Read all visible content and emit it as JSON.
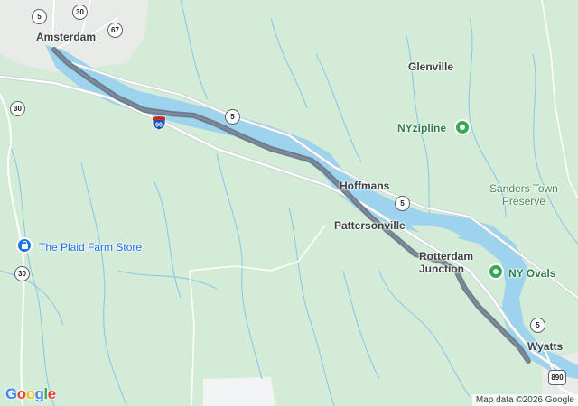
{
  "map": {
    "places": {
      "amsterdam": "Amsterdam",
      "glenville": "Glenville",
      "hoffmans": "Hoffmans",
      "pattersonville": "Pattersonville",
      "rotterdam_junction_1": "Rotterdam",
      "rotterdam_junction_2": "Junction",
      "wyatts": "Wyatts"
    },
    "pois": {
      "nyzipline": "NYzipline",
      "ny_ovals": "NY Ovals",
      "plaid_farm_store": "The Plaid Farm Store",
      "sanders_town_1": "Sanders Town",
      "sanders_town_2": "Preserve"
    },
    "route_shields": {
      "s5_a": "5",
      "s5_b": "5",
      "s5_c": "5",
      "s5_d": "5",
      "s30_a": "30",
      "s30_b": "30",
      "s30_c": "30",
      "s67": "67",
      "i90": "90",
      "s890": "890"
    },
    "colors": {
      "land": "#d4ebd8",
      "water": "#9ed3ee",
      "route": "#5f6b7a",
      "road": "#ffffff",
      "poi_green": "#34a853",
      "poi_blue": "#1a73e8"
    }
  },
  "footer": {
    "logo_g": "G",
    "logo_o1": "o",
    "logo_o2": "o",
    "logo_g2": "g",
    "logo_l": "l",
    "logo_e": "e",
    "attribution": "Map data ©2026 Google"
  }
}
